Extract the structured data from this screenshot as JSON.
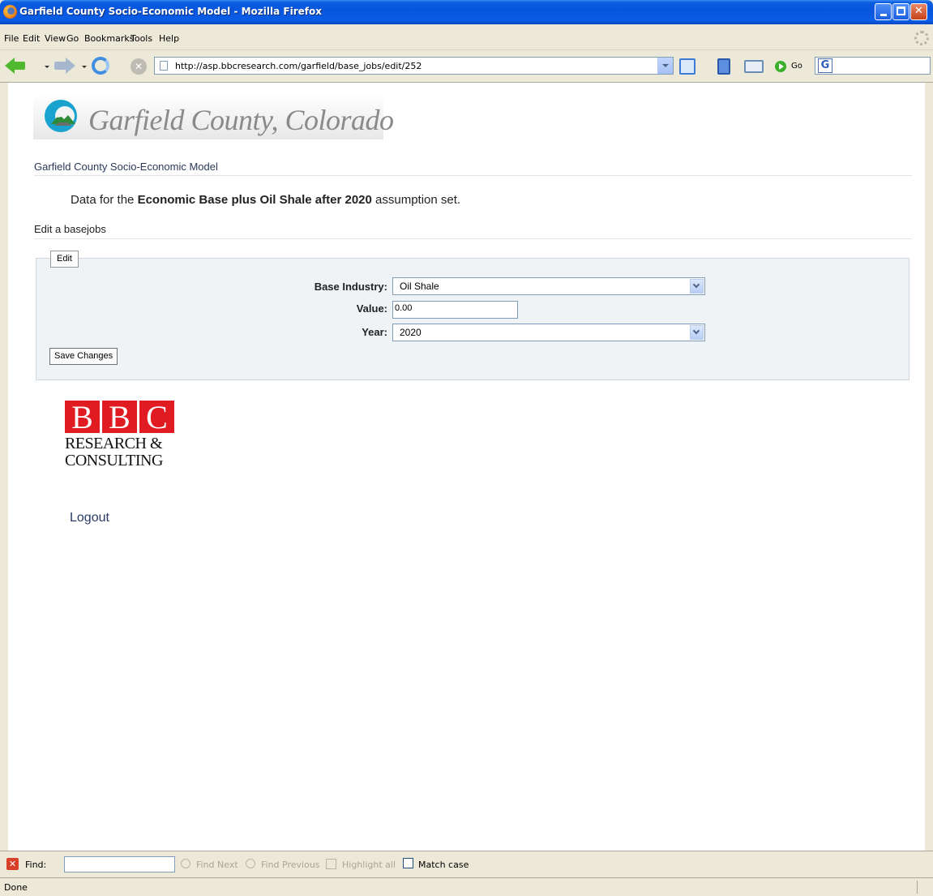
{
  "window": {
    "title": "Garfield County Socio-Economic Model - Mozilla Firefox"
  },
  "menu": {
    "items": [
      "File",
      "Edit",
      "View",
      "Go",
      "Bookmarks",
      "Tools",
      "Help"
    ]
  },
  "toolbar": {
    "url": "http://asp.bbcresearch.com/garfield/base_jobs/edit/252",
    "go_label": "Go"
  },
  "page": {
    "logo_text": "Garfield County, Colorado",
    "site_name": "Garfield County Socio-Economic Model",
    "dataset_prefix": "Data for the",
    "dataset_name": "Economic Base plus Oil Shale after 2020",
    "dataset_suffix": "assumption set.",
    "section_title": "Edit a basejobs",
    "form": {
      "legend": "Edit",
      "base_industry_label": "Base Industry:",
      "base_industry_value": "Oil Shale",
      "value_label": "Value:",
      "value_value": "0.00",
      "year_label": "Year:",
      "year_value": "2020",
      "save_label": "Save Changes"
    },
    "bbc_logo": {
      "letters": [
        "B",
        "B",
        "C"
      ],
      "line1": "RESEARCH &",
      "line2": "CONSULTING"
    },
    "logout_label": "Logout"
  },
  "findbar": {
    "find_label": "Find:",
    "find_next": "Find Next",
    "find_previous": "Find Previous",
    "highlight_all": "Highlight all",
    "match_case": "Match case"
  },
  "status": {
    "text": "Done"
  },
  "colors": {
    "titlebar": "#0855dd",
    "bbc_red": "#e11b22",
    "fieldset_bg": "#f0f3f6"
  }
}
